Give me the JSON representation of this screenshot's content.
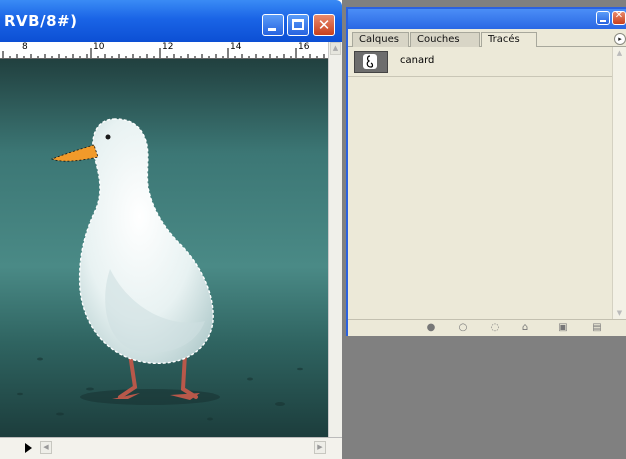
{
  "document": {
    "title": "RVB/8#)",
    "ruler_labels": [
      "8",
      "10",
      "12",
      "14",
      "16"
    ],
    "window_buttons": {
      "minimize": "minimize-icon",
      "maximize": "maximize-icon",
      "close": "close-icon"
    }
  },
  "panel": {
    "tabs": [
      {
        "label": "Calques",
        "active": false
      },
      {
        "label": "Couches",
        "active": false
      },
      {
        "label": "Tracés",
        "active": true
      }
    ],
    "paths": [
      {
        "label": "canard",
        "icon": "path-thumbnail-icon"
      }
    ],
    "footer_icons": [
      "fill-path-icon",
      "stroke-path-icon",
      "load-selection-icon",
      "make-work-path-icon",
      "new-path-icon",
      "delete-path-icon"
    ]
  },
  "colors": {
    "titlebar": "#1a64e6",
    "panel_border": "#2b62e0",
    "panel_bg": "#ece9d8",
    "workspace_gray": "#808080"
  }
}
